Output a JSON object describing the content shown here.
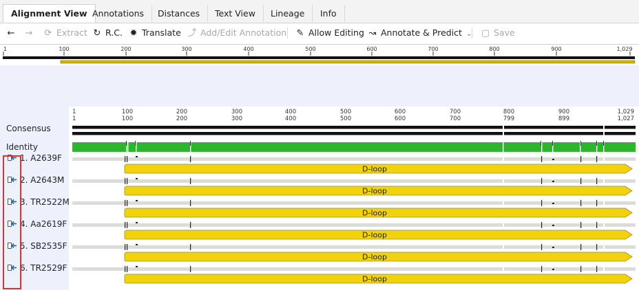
{
  "tabs": [
    {
      "label": "Alignment View",
      "active": true
    },
    {
      "label": "Annotations"
    },
    {
      "label": "Distances"
    },
    {
      "label": "Text View"
    },
    {
      "label": "Lineage"
    },
    {
      "label": "Info"
    }
  ],
  "toolbar": {
    "back": "",
    "forward": "",
    "extract": "Extract",
    "rc": "R.C.",
    "translate": "Translate",
    "add_edit_annotation": "Add/Edit Annotation",
    "allow_editing": "Allow Editing",
    "annotate_predict": "Annotate & Predict",
    "save": "Save"
  },
  "overview_ruler": {
    "ticks": [
      "1",
      "100",
      "200",
      "300",
      "400",
      "500",
      "600",
      "700",
      "800",
      "900",
      "1,029"
    ]
  },
  "alignment": {
    "consensus_label": "Consensus",
    "identity_label": "Identity",
    "ruler_top": [
      "1",
      "100",
      "200",
      "300",
      "400",
      "500",
      "600",
      "700",
      "800",
      "900",
      "1,029"
    ],
    "ruler_bottom": [
      "1",
      "100",
      "200",
      "300",
      "400",
      "500",
      "600",
      "700",
      "799",
      "899",
      "1,027"
    ],
    "sequences": [
      {
        "name": "1. A2639F",
        "annotation": "D-loop"
      },
      {
        "name": "2. A2643M",
        "annotation": "D-loop"
      },
      {
        "name": "3. TR2522M",
        "annotation": "D-loop"
      },
      {
        "name": "4. Aa2619F",
        "annotation": "D-loop"
      },
      {
        "name": "5. SB2535F",
        "annotation": "D-loop"
      },
      {
        "name": "6. TR2529F",
        "annotation": "D-loop"
      }
    ]
  },
  "colors": {
    "identity_green": "#2db52d",
    "annotation_yellow": "#f2d20c",
    "highlight_red": "#e0302a",
    "icon_blue": "#1f6fb8"
  }
}
